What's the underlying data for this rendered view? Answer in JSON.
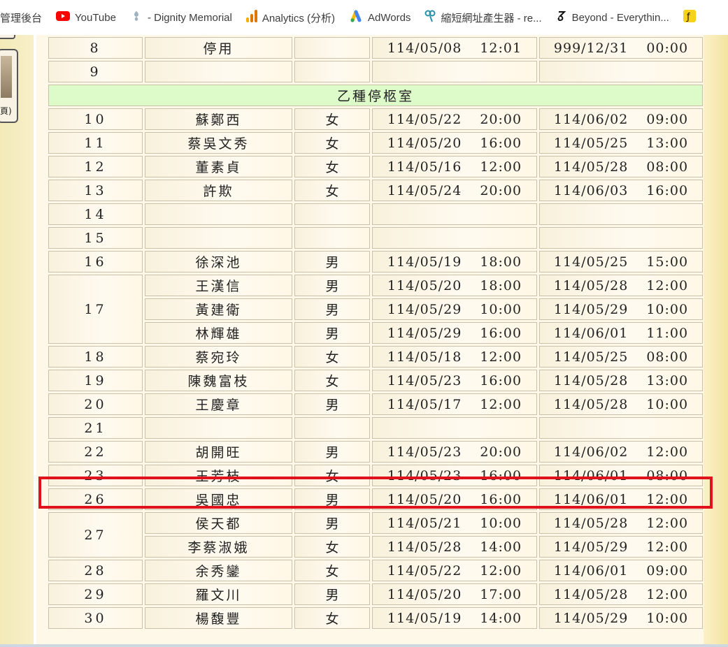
{
  "bookmarks": [
    {
      "label": "管理後台",
      "icon": "none"
    },
    {
      "label": "YouTube",
      "icon": "youtube-icon"
    },
    {
      "label": "- Dignity Memorial",
      "icon": "dignity-memorial-icon"
    },
    {
      "label": "Analytics (分析)",
      "icon": "analytics-icon"
    },
    {
      "label": "AdWords",
      "icon": "adwords-icon"
    },
    {
      "label": "縮短網址產生器 - re...",
      "icon": "url-shortener-icon"
    },
    {
      "label": "Beyond - Everythin...",
      "icon": "beyond-icon"
    }
  ],
  "sidebar_widget_text": "頁)",
  "rows_top": [
    {
      "no": "8",
      "name": "停用",
      "sex": "",
      "in_date": "114/05/08",
      "in_time": "12:01",
      "out_date": "999/12/31",
      "out_time": "00:00"
    },
    {
      "no": "9",
      "name": "",
      "sex": "",
      "in_date": "",
      "in_time": "",
      "out_date": "",
      "out_time": ""
    }
  ],
  "section_title": "乙種停柩室",
  "rows": [
    {
      "no": "10",
      "name": "蘇鄭西",
      "sex": "女",
      "in_date": "114/05/22",
      "in_time": "20:00",
      "out_date": "114/06/02",
      "out_time": "09:00"
    },
    {
      "no": "11",
      "name": "蔡吳文秀",
      "sex": "女",
      "in_date": "114/05/20",
      "in_time": "16:00",
      "out_date": "114/05/25",
      "out_time": "13:00"
    },
    {
      "no": "12",
      "name": "董素貞",
      "sex": "女",
      "in_date": "114/05/16",
      "in_time": "12:00",
      "out_date": "114/05/28",
      "out_time": "08:00"
    },
    {
      "no": "13",
      "name": "許欺",
      "sex": "女",
      "in_date": "114/05/24",
      "in_time": "20:00",
      "out_date": "114/06/03",
      "out_time": "16:00"
    },
    {
      "no": "14",
      "name": "",
      "sex": "",
      "in_date": "",
      "in_time": "",
      "out_date": "",
      "out_time": ""
    },
    {
      "no": "15",
      "name": "",
      "sex": "",
      "in_date": "",
      "in_time": "",
      "out_date": "",
      "out_time": ""
    },
    {
      "no": "16",
      "name": "徐深池",
      "sex": "男",
      "in_date": "114/05/19",
      "in_time": "18:00",
      "out_date": "114/05/25",
      "out_time": "15:00"
    },
    {
      "no": "17",
      "name": "王漢信",
      "sex": "男",
      "in_date": "114/05/20",
      "in_time": "18:00",
      "out_date": "114/05/28",
      "out_time": "12:00"
    },
    {
      "no": "",
      "name": "黃建衛",
      "sex": "男",
      "in_date": "114/05/29",
      "in_time": "10:00",
      "out_date": "114/05/29",
      "out_time": "10:00"
    },
    {
      "no": "",
      "name": "林輝雄",
      "sex": "男",
      "in_date": "114/05/29",
      "in_time": "16:00",
      "out_date": "114/06/01",
      "out_time": "11:00"
    },
    {
      "no": "18",
      "name": "蔡宛玲",
      "sex": "女",
      "in_date": "114/05/18",
      "in_time": "12:00",
      "out_date": "114/05/25",
      "out_time": "08:00"
    },
    {
      "no": "19",
      "name": "陳魏富枝",
      "sex": "女",
      "in_date": "114/05/23",
      "in_time": "16:00",
      "out_date": "114/05/28",
      "out_time": "13:00"
    },
    {
      "no": "20",
      "name": "王慶章",
      "sex": "男",
      "in_date": "114/05/17",
      "in_time": "12:00",
      "out_date": "114/05/28",
      "out_time": "10:00"
    },
    {
      "no": "21",
      "name": "",
      "sex": "",
      "in_date": "",
      "in_time": "",
      "out_date": "",
      "out_time": ""
    },
    {
      "no": "22",
      "name": "胡開旺",
      "sex": "男",
      "in_date": "114/05/23",
      "in_time": "20:00",
      "out_date": "114/06/02",
      "out_time": "12:00"
    },
    {
      "no": "23",
      "name": "王芳枝",
      "sex": "女",
      "in_date": "114/05/23",
      "in_time": "16:00",
      "out_date": "114/06/01",
      "out_time": "08:00"
    },
    {
      "no": "26",
      "name": "吳國忠",
      "sex": "男",
      "in_date": "114/05/20",
      "in_time": "16:00",
      "out_date": "114/06/01",
      "out_time": "12:00"
    },
    {
      "no": "27",
      "name": "侯天都",
      "sex": "男",
      "in_date": "114/05/21",
      "in_time": "10:00",
      "out_date": "114/05/28",
      "out_time": "12:00"
    },
    {
      "no": "",
      "name": "李蔡淑娥",
      "sex": "女",
      "in_date": "114/05/28",
      "in_time": "14:00",
      "out_date": "114/05/29",
      "out_time": "12:00"
    },
    {
      "no": "28",
      "name": "余秀鑾",
      "sex": "女",
      "in_date": "114/05/22",
      "in_time": "12:00",
      "out_date": "114/06/01",
      "out_time": "09:00"
    },
    {
      "no": "29",
      "name": "羅文川",
      "sex": "男",
      "in_date": "114/05/20",
      "in_time": "17:00",
      "out_date": "114/05/28",
      "out_time": "12:00"
    },
    {
      "no": "30",
      "name": "楊馥豐",
      "sex": "女",
      "in_date": "114/05/19",
      "in_time": "14:00",
      "out_date": "114/05/29",
      "out_time": "10:00"
    }
  ],
  "highlight_color": "#e0121b",
  "section_color": "#ddfbc9"
}
